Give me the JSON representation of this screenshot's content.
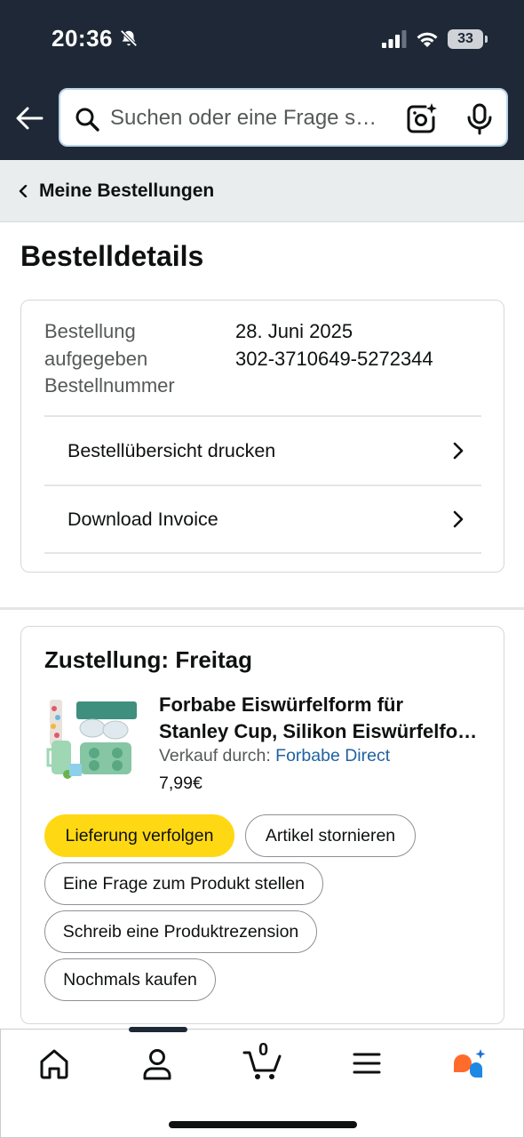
{
  "status_bar": {
    "time": "20:36",
    "battery": "33"
  },
  "search": {
    "placeholder": "Suchen oder eine Frage s…"
  },
  "breadcrumb": {
    "label": "Meine Bestellungen"
  },
  "page": {
    "title": "Bestelldetails"
  },
  "order_info": {
    "label_line1": "Bestellung",
    "label_line2": "aufgegeben",
    "label_line3": "Bestellnummer",
    "date": "28. Juni 2025",
    "order_number": "302-3710649-5272344",
    "links": [
      {
        "label": "Bestellübersicht drucken"
      },
      {
        "label": "Download Invoice"
      }
    ]
  },
  "delivery": {
    "title": "Zustellung: Freitag",
    "product": {
      "title_line1": "Forbabe Eiswürfelform für",
      "title_line2": "Stanley Cup, Silikon Eiswürfelfo…",
      "seller_prefix": "Verkauf durch: ",
      "seller_name": "Forbabe Direct",
      "price": "7,99€"
    },
    "actions": {
      "track": "Lieferung verfolgen",
      "cancel": "Artikel stornieren",
      "ask": "Eine Frage zum Produkt stellen",
      "review": "Schreib eine Produktrezension",
      "rebuy": "Nochmals kaufen"
    }
  },
  "bottom_nav": {
    "cart_count": "0"
  },
  "colors": {
    "header_bg": "#1e2836",
    "primary_button": "#ffd814",
    "link": "#2162a1",
    "breadcrumb_bg": "#eaeded"
  }
}
